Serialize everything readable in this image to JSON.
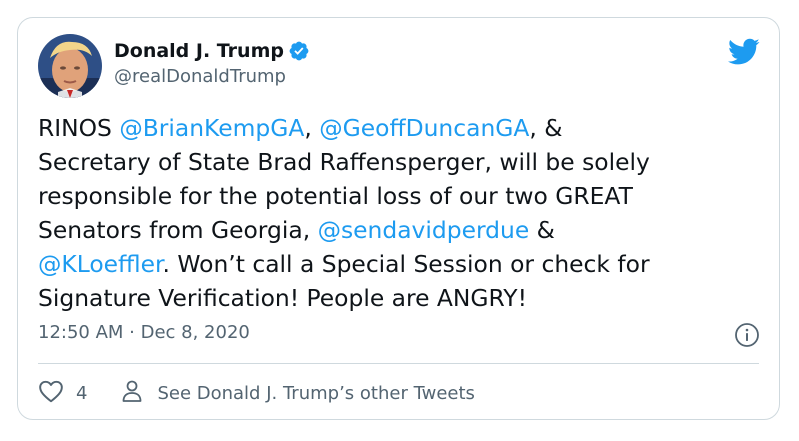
{
  "tweet": {
    "author": {
      "display_name": "Donald J. Trump",
      "handle": "@realDonaldTrump",
      "verified": true
    },
    "text_segments": [
      {
        "text": "RINOS ",
        "type": "text"
      },
      {
        "text": "@BrianKempGA",
        "type": "mention"
      },
      {
        "text": ", ",
        "type": "text"
      },
      {
        "text": "@GeoffDuncanGA",
        "type": "mention"
      },
      {
        "text": ", &\nSecretary of State Brad Raffensperger, will be solely\nresponsible for the potential loss of our two GREAT\nSenators from Georgia, ",
        "type": "text"
      },
      {
        "text": "@sendavidperdue",
        "type": "mention"
      },
      {
        "text": " &\n",
        "type": "text"
      },
      {
        "text": "@KLoeffler",
        "type": "mention"
      },
      {
        "text": ". Won’t call a Special Session or check for\nSignature Verification! People are ANGRY!",
        "type": "text"
      }
    ],
    "timestamp": "12:50 AM · Dec 8, 2020",
    "like_count": "4",
    "other_tweets_label": "See Donald J. Trump’s other Tweets"
  },
  "icons": {
    "brand": "twitter-bird-icon",
    "verified": "verified-badge-icon",
    "info": "info-icon",
    "like": "heart-icon",
    "profile": "person-icon"
  },
  "colors": {
    "accent": "#1d9bf0",
    "text": "#0f1419",
    "muted": "#536471",
    "border": "#cfd9de"
  }
}
